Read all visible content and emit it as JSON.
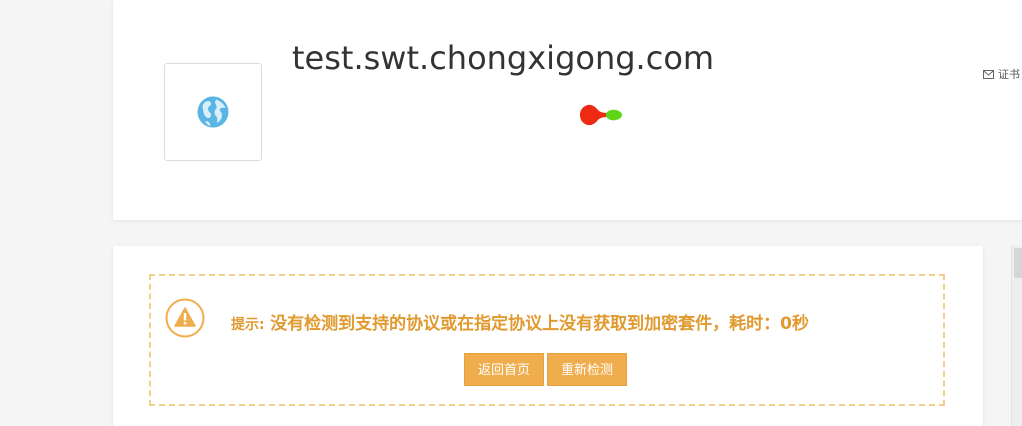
{
  "domain": {
    "name": "test.swt.chongxigong.com",
    "favicon_icon": "globe-icon"
  },
  "header": {
    "cert_link_label": "证书",
    "cert_icon": "envelope-icon"
  },
  "notice": {
    "label": "提示:",
    "message": "没有检测到支持的协议或在指定协议上没有获取到加密套件，耗时：0秒",
    "icon": "warning-icon"
  },
  "buttons": {
    "home": "返回首页",
    "recheck": "重新检测"
  },
  "colors": {
    "accent": "#f0ad4e",
    "notice_text": "#e09a2f",
    "notice_border": "#f0d08a"
  }
}
